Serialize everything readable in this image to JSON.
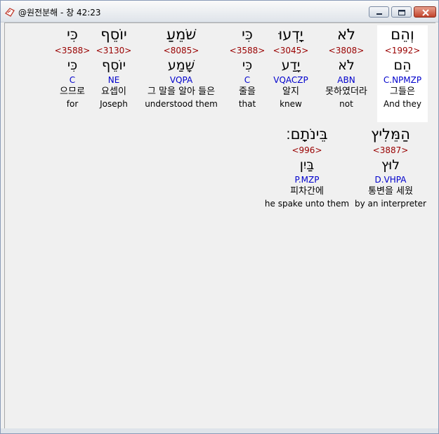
{
  "window": {
    "title": "@원전분해 - 창 42:23",
    "icon": "app-icon",
    "buttons": {
      "minimize": "minimize-button",
      "maximize": "maximize-button",
      "close": "close-button"
    }
  },
  "words": [
    {
      "hebrew": "וְהֵם",
      "strong": "<1992>",
      "lemma": "הֵם",
      "morph": "C.NPMZP",
      "korean": "그들은",
      "english": "And they"
    },
    {
      "hebrew": "לֹא",
      "strong": "<3808>",
      "lemma": "לֹא",
      "morph": "ABN",
      "korean": "못하였더라",
      "english": "not"
    },
    {
      "hebrew": "יָדְעוּ",
      "strong": "<3045>",
      "lemma": "יָדַע",
      "morph": "VQACZP",
      "korean": "알지",
      "english": "knew"
    },
    {
      "hebrew": "כִּי",
      "strong": "<3588>",
      "lemma": "כִּי",
      "morph": "C",
      "korean": "줄을",
      "english": "that"
    },
    {
      "hebrew": "שֹׁמֵעַ",
      "strong": "<8085>",
      "lemma": "שָׁמַע",
      "morph": "VQPA",
      "korean": "그 말을 알아 들은",
      "english": "understood them"
    },
    {
      "hebrew": "יוֹסֵף",
      "strong": "<3130>",
      "lemma": "יוֹסֵף",
      "morph": "NE",
      "korean": "요셉이",
      "english": "Joseph"
    },
    {
      "hebrew": "כִּי",
      "strong": "<3588>",
      "lemma": "כִּי",
      "morph": "C",
      "korean": "으므로",
      "english": "for"
    },
    {
      "hebrew": "הַמֵּלִיץ",
      "strong": "<3887>",
      "lemma": "לוּץ",
      "morph": "D.VHPA",
      "korean": "통변을 세웠",
      "english": "by an interpreter"
    },
    {
      "hebrew": "בֵּינֹתָם׃",
      "strong": "<996>",
      "lemma": "בַּיִן",
      "morph": "P.MZP",
      "korean": "피차간에",
      "english": "he spake unto them"
    }
  ]
}
